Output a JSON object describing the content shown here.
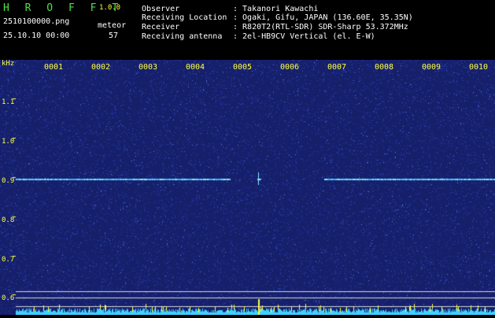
{
  "header": {
    "brand": "H R O F F T",
    "version": "1.0.0",
    "filename": "2510100000.png",
    "datetime": "25.10.10 00:00",
    "meteor_label": "meteor",
    "meteor_count": "57",
    "fields": [
      {
        "label": "Observer",
        "value": ": Takanori Kawachi"
      },
      {
        "label": "Receiving Location",
        "value": ": Ogaki, Gifu, JAPAN (136.60E, 35.35N)"
      },
      {
        "label": "Receiver",
        "value": ": R820T2(RTL-SDR) SDR-Sharp 53.372MHz"
      },
      {
        "label": "Receiving antenna",
        "value": ": 2el-HB9CV Vertical (el. E-W)"
      }
    ]
  },
  "axis": {
    "unit": "kHz",
    "y_ticks": [
      "1.1",
      "1.0",
      "0.9",
      "0.8",
      "0.7",
      "0.6"
    ],
    "x_ticks": [
      "0001",
      "0002",
      "0003",
      "0004",
      "0005",
      "0006",
      "0007",
      "0008",
      "0009",
      "0010"
    ]
  },
  "colors": {
    "background": "#1a2470",
    "signal": "#4fd0ff",
    "label": "#ffff40",
    "title": "#4be04b"
  },
  "signal": {
    "frequency_khz": 0.9
  }
}
